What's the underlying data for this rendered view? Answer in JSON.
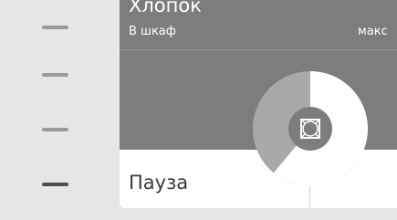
{
  "program": {
    "title": "Хлопок",
    "subtitle": "В шкаф",
    "temperature": "макс"
  },
  "controls": {
    "pause_label": "Пауза"
  },
  "progress": {
    "fraction": 0.61
  },
  "sidebar": {
    "items": [
      {
        "name": "sidebar-item-1",
        "active": false
      },
      {
        "name": "sidebar-item-2",
        "active": false
      },
      {
        "name": "sidebar-item-3",
        "active": false
      },
      {
        "name": "sidebar-item-4",
        "active": true
      }
    ]
  },
  "colors": {
    "header_bg": "#7d7d7d",
    "progress_done": "#ffffff",
    "progress_remaining": "#a9a9a9",
    "hub": "#7d7d7d"
  },
  "icons": {
    "dial_center": "drying-square-icon"
  }
}
